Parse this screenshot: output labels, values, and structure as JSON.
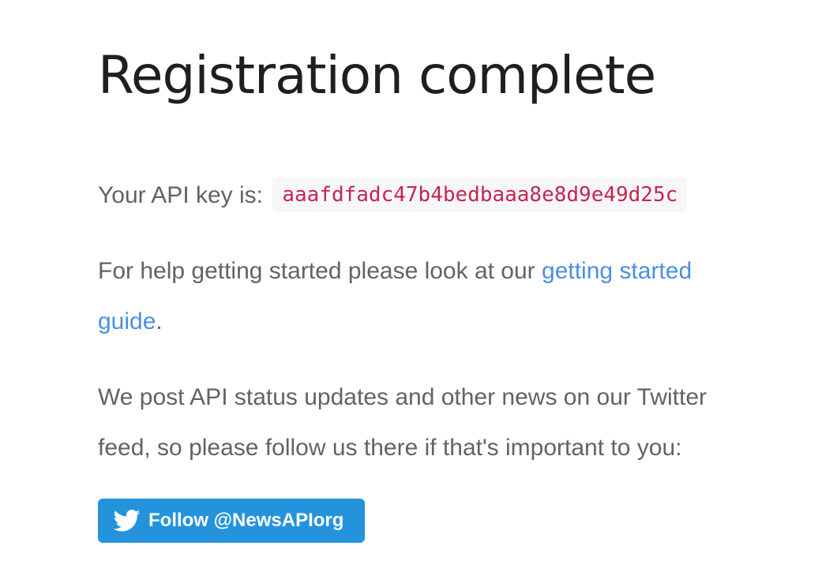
{
  "page": {
    "title": "Registration complete"
  },
  "api_key": {
    "label": "Your API key is:",
    "value": "aaafdfadc47b4bedbaaa8e8d9e49d25c"
  },
  "help": {
    "prefix_line1": "For help getting started please look at our ",
    "link_line1": "getting started",
    "link_line2": "guide",
    "suffix": "."
  },
  "twitter": {
    "line1": "We post API status updates and other news on our Twitter",
    "line2": "feed, so please follow us there if that's important to you:",
    "follow_label": "Follow @NewsAPIorg",
    "icon": "twitter-bird-icon",
    "button_color": "#2493dc"
  },
  "colors": {
    "link": "#4a90e2",
    "api_key_text": "#c7254e",
    "api_key_bg": "#f7f7f9",
    "body_text": "#5f6368",
    "title_text": "#1f1f1f"
  }
}
